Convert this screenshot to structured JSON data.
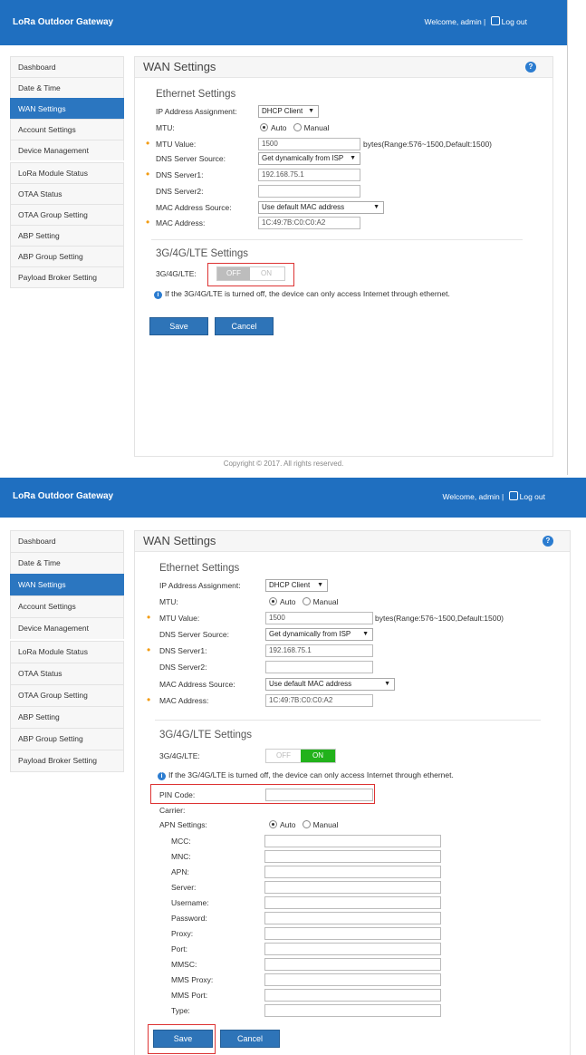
{
  "top": {
    "header": {
      "brand": "LoRa Outdoor Gateway",
      "welcome": "Welcome, admin | ",
      "logout": "Log out"
    },
    "sidebar": [
      "Dashboard",
      "Date & Time",
      "WAN Settings",
      "Account Settings",
      "Device Management",
      "LoRa Module Status",
      "OTAA Status",
      "OTAA Group Setting",
      "ABP Setting",
      "ABP Group Setting",
      "Payload Broker Setting"
    ],
    "page_title": "WAN Settings",
    "ethernet": {
      "title": "Ethernet Settings",
      "ip_label": "IP Address Assignment:",
      "ip_value": "DHCP Client",
      "mtu_label": "MTU:",
      "mtu_auto": "Auto",
      "mtu_manual": "Manual",
      "mtu_value_label": "MTU Value:",
      "mtu_value": "1500",
      "mtu_hint": "bytes(Range:576~1500,Default:1500)",
      "dns_source_label": "DNS Server Source:",
      "dns_source_value": "Get dynamically from ISP",
      "dns1_label": "DNS Server1:",
      "dns1_value": "192.168.75.1",
      "dns2_label": "DNS Server2:",
      "dns2_value": "",
      "mac_source_label": "MAC Address Source:",
      "mac_source_value": "Use default MAC address",
      "mac_label": "MAC Address:",
      "mac_value": "1C:49:7B:C0:C0:A2"
    },
    "lte": {
      "title": "3G/4G/LTE Settings",
      "label": "3G/4G/LTE:",
      "off": "OFF",
      "on": "ON",
      "info": "If the 3G/4G/LTE is turned off, the device can only access Internet through ethernet."
    },
    "buttons": {
      "save": "Save",
      "cancel": "Cancel"
    },
    "copyright": "Copyright © 2017. All rights reserved."
  },
  "bottom": {
    "header": {
      "brand": "LoRa Outdoor Gateway",
      "welcome": "Welcome, admin | ",
      "logout": "Log out"
    },
    "sidebar": [
      "Dashboard",
      "Date & Time",
      "WAN Settings",
      "Account Settings",
      "Device Management",
      "LoRa Module Status",
      "OTAA Status",
      "OTAA Group Setting",
      "ABP Setting",
      "ABP Group Setting",
      "Payload Broker Setting"
    ],
    "page_title": "WAN Settings",
    "ethernet": {
      "title": "Ethernet Settings",
      "ip_label": "IP Address Assignment:",
      "ip_value": "DHCP Client",
      "mtu_label": "MTU:",
      "mtu_auto": "Auto",
      "mtu_manual": "Manual",
      "mtu_value_label": "MTU Value:",
      "mtu_value": "1500",
      "mtu_hint": "bytes(Range:576~1500,Default:1500)",
      "dns_source_label": "DNS Server Source:",
      "dns_source_value": "Get dynamically from ISP",
      "dns1_label": "DNS Server1:",
      "dns1_value": "192.168.75.1",
      "dns2_label": "DNS Server2:",
      "dns2_value": "",
      "mac_source_label": "MAC Address Source:",
      "mac_source_value": "Use default MAC address",
      "mac_label": "MAC Address:",
      "mac_value": "1C:49:7B:C0:C0:A2"
    },
    "lte": {
      "title": "3G/4G/LTE Settings",
      "label": "3G/4G/LTE:",
      "off": "OFF",
      "on": "ON",
      "info": "If the 3G/4G/LTE is turned off, the device can only access Internet through ethernet.",
      "pin_label": "PIN Code:",
      "carrier_label": "Carrier:",
      "apn_label": "APN Settings:",
      "apn_auto": "Auto",
      "apn_manual": "Manual",
      "apn_fields": [
        "MCC:",
        "MNC:",
        "APN:",
        "Server:",
        "Username:",
        "Password:",
        "Proxy:",
        "Port:",
        "MMSC:",
        "MMS Proxy:",
        "MMS Port:",
        "Type:"
      ]
    },
    "buttons": {
      "save": "Save",
      "cancel": "Cancel"
    }
  },
  "colors": {
    "header": "#1f6fc0",
    "active": "#2b76c0",
    "toggle_on": "#22b21b",
    "highlight": "#dd3333"
  }
}
